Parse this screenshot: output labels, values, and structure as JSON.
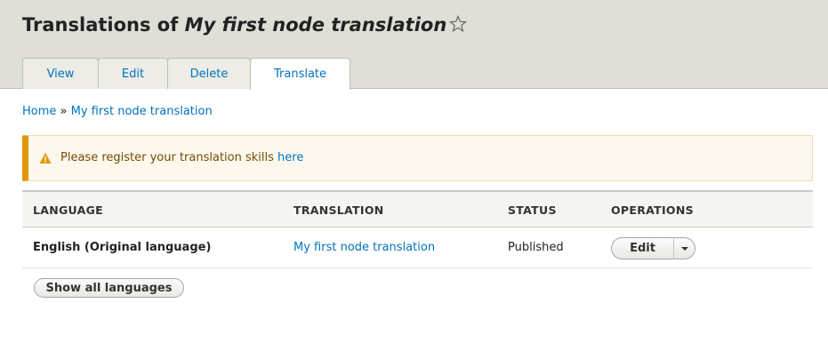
{
  "header": {
    "title_prefix": "Translations of",
    "title_node": "My first node translation"
  },
  "tabs": [
    {
      "label": "View"
    },
    {
      "label": "Edit"
    },
    {
      "label": "Delete"
    },
    {
      "label": "Translate",
      "active": true
    }
  ],
  "breadcrumb": {
    "home": "Home",
    "separator": "»",
    "current": "My first node translation"
  },
  "message": {
    "type": "warning",
    "text": "Please register your translation skills",
    "link": "here",
    "icon": "warning-icon",
    "accent_color": "#e09600"
  },
  "table": {
    "headers": [
      "LANGUAGE",
      "TRANSLATION",
      "STATUS",
      "OPERATIONS"
    ],
    "rows": [
      {
        "language": "English (Original language)",
        "translation": "My first node translation",
        "status": "Published",
        "operation": "Edit"
      }
    ]
  },
  "show_all_label": "Show all languages",
  "colors": {
    "link": "#0074bd",
    "header_bg": "#e0dfd7"
  }
}
